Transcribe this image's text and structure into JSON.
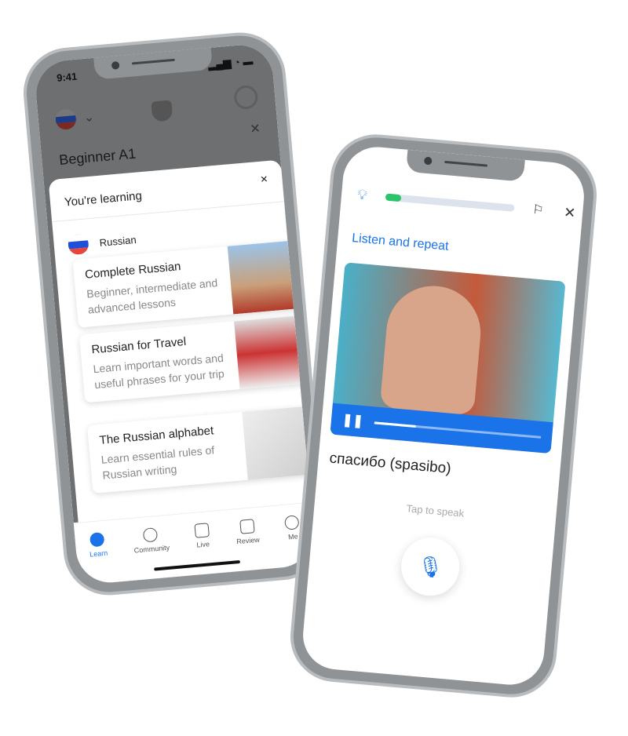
{
  "left_phone": {
    "status": {
      "time": "9:41"
    },
    "header": {
      "level": "Beginner A1"
    },
    "sheet": {
      "title": "You're learning",
      "language": "Russian",
      "courses": [
        {
          "title": "Complete Russian",
          "desc": "Beginner, intermediate and advanced lessons"
        },
        {
          "title": "Russian for Travel",
          "desc": "Learn important words and useful phrases for your trip"
        },
        {
          "title": "The Russian alphabet",
          "desc": "Learn essential rules of Russian writing"
        }
      ]
    },
    "nav": [
      {
        "label": "Learn",
        "active": true
      },
      {
        "label": "Community"
      },
      {
        "label": "Live"
      },
      {
        "label": "Review"
      },
      {
        "label": "Me"
      }
    ]
  },
  "right_phone": {
    "progress": 0.12,
    "instruction": "Listen and repeat",
    "video_progress": 0.25,
    "phrase": "спасибо (spasibo)",
    "tap_hint": "Tap to speak"
  },
  "colors": {
    "accent": "#1a73e8",
    "progress": "#2bc46a"
  }
}
